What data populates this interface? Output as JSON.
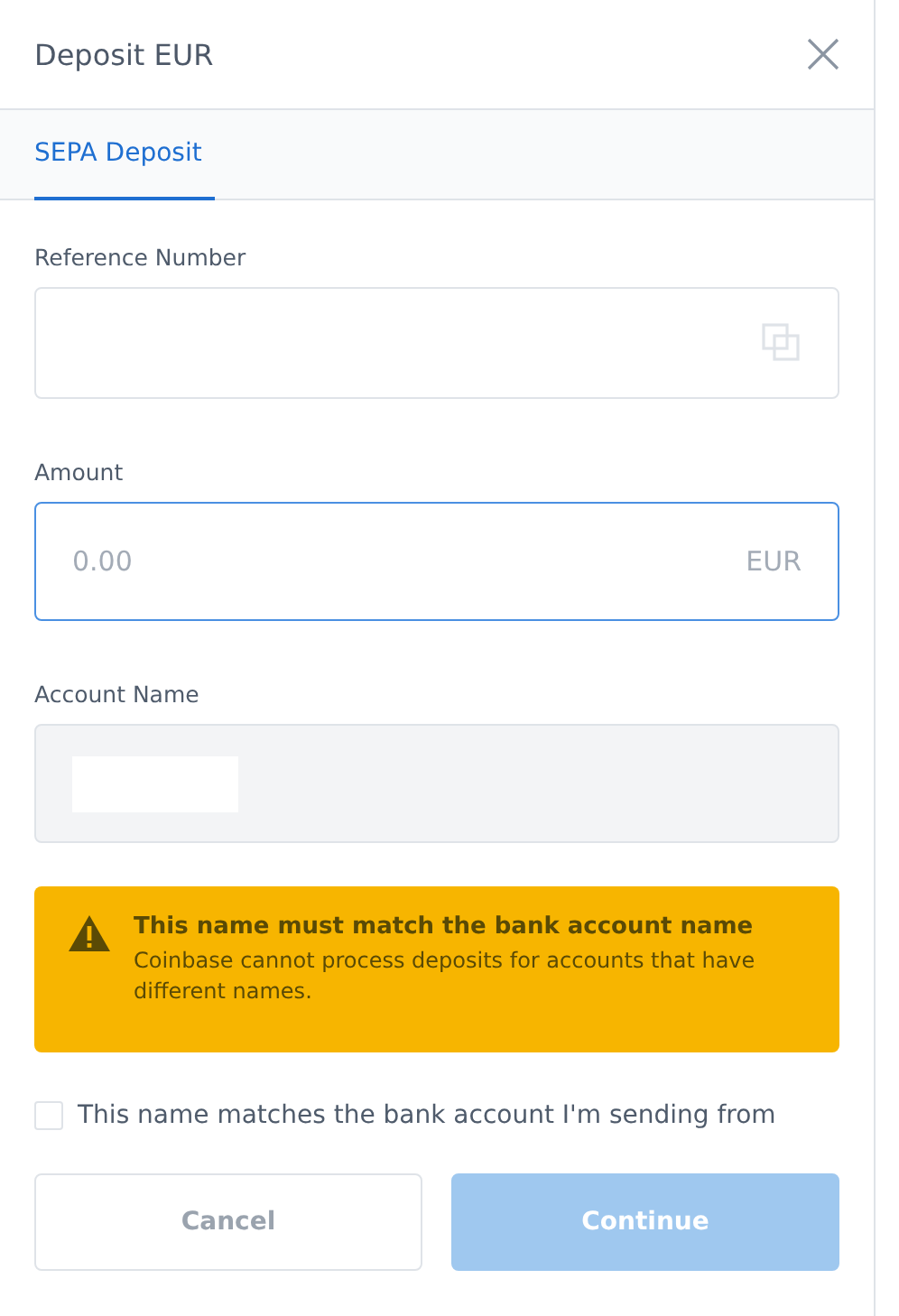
{
  "window": {
    "title": "Deposit EUR"
  },
  "tabs": [
    {
      "label": "SEPA Deposit",
      "selected": true
    }
  ],
  "fields": [
    {
      "kind": "copy",
      "label": "Reference Number"
    },
    {
      "kind": "amount",
      "label": "Amount",
      "placeholder": "0.00",
      "suffix": "EUR",
      "focused": true
    },
    {
      "kind": "readonly",
      "label": "Account Name",
      "redacted": true
    }
  ],
  "warning": {
    "title": "This name must match the bank account name",
    "message": "Coinbase cannot process deposits for accounts that have different names."
  },
  "confirm": {
    "label": "This name matches the bank account I'm sending from",
    "checked": false
  },
  "buttons": [
    {
      "label": "Cancel",
      "kind": "secondary",
      "disabled": false
    },
    {
      "label": "Continue",
      "kind": "primary",
      "disabled": true
    }
  ]
}
